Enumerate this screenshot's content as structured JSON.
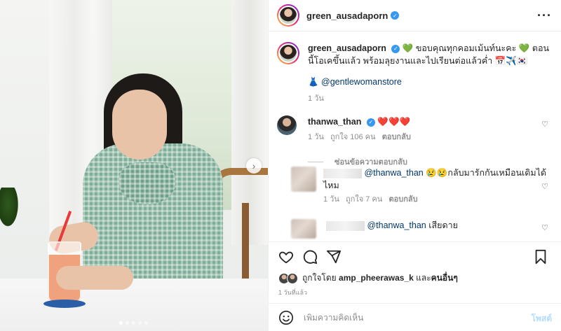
{
  "post": {
    "username": "green_ausadaporn",
    "verified": true,
    "more_icon": "more-horizontal-icon",
    "image_dots": 5,
    "image_dot_active": 1
  },
  "caption": {
    "username": "green_ausadaporn",
    "line1": "💚 ขอบคุณทุกคอมเม้นท์นะคะ 💚 ตอนนี้โอเคขึ้นแล้ว พร้อมลุยงานและไปเรียนต่อแล้วค่ำ 📅✈️🇰🇷",
    "tag_line": "👗 @gentlewomanstore",
    "time": "1 วัน"
  },
  "comments": [
    {
      "username": "thanwa_than",
      "text": "❤️❤️❤️",
      "time": "1 วัน",
      "likes": "ถูกใจ 106 คน",
      "reply_label": "ตอบกลับ",
      "hide_replies": "ซ่อนข้อความตอบกลับ"
    },
    {
      "mention": "@thanwa_than",
      "text": "😢😢กลับมารักกันเหมือนเดิมได้ไหม",
      "time": "1 วัน",
      "likes": "ถูกใจ 7 คน",
      "reply_label": "ตอบกลับ"
    },
    {
      "mention": "@thanwa_than",
      "text": "เสียดาย"
    }
  ],
  "likes_line": {
    "prefix": "ถูกใจโดย",
    "user": "amp_pheerawas_k",
    "joiner": "และ",
    "others": "คนอื่นๆ"
  },
  "timestamp": "1 วันที่แล้ว",
  "composer": {
    "placeholder": "เพิ่มความคิดเห็น",
    "post_label": "โพสต์"
  },
  "colors": {
    "verified_blue": "#3897f0",
    "heart_red": "#ed4956",
    "post_button": "#b3dbff",
    "mention": "#00376b"
  }
}
